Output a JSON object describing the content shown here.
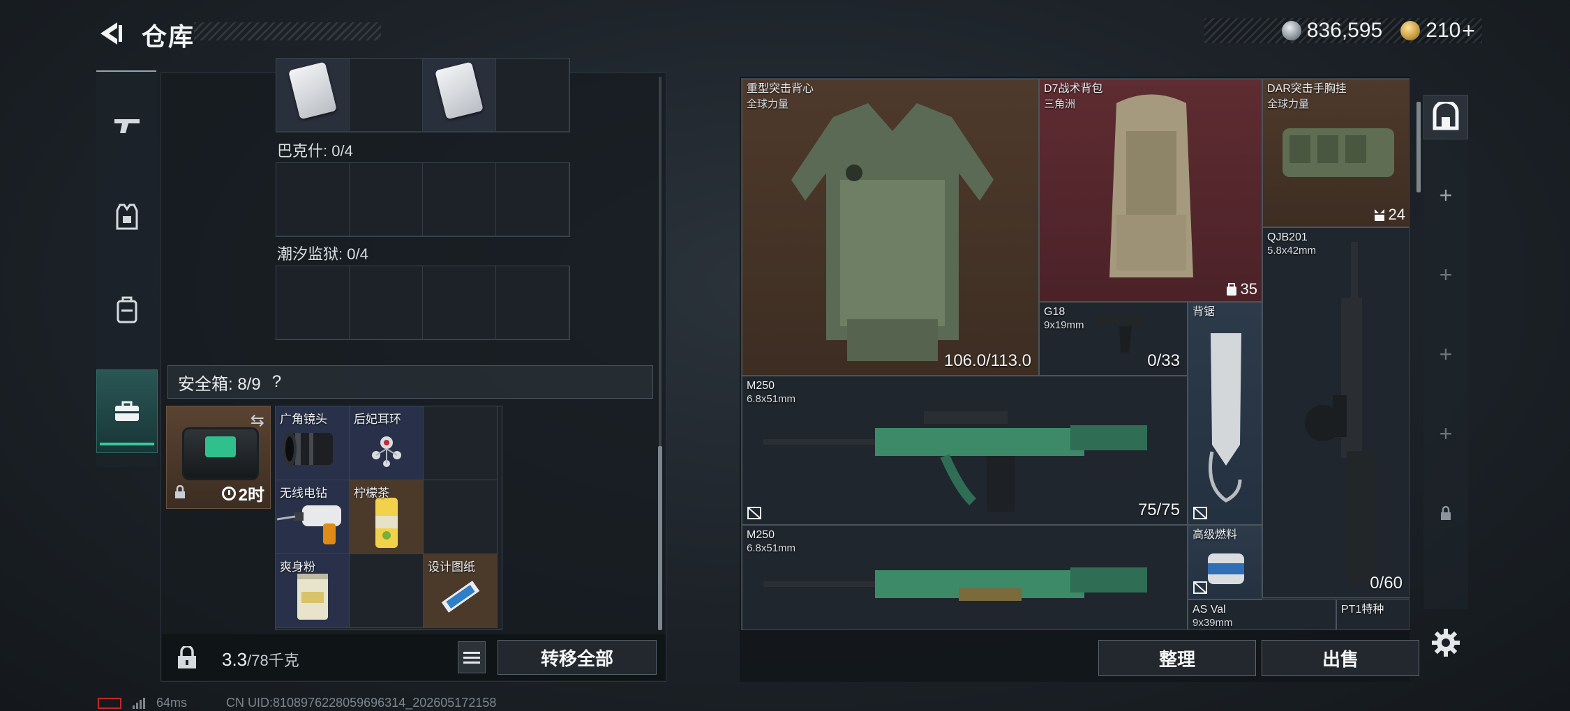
{
  "header": {
    "title": "仓库",
    "currency": [
      {
        "icon": "silver-coin-icon",
        "value": "836,595"
      },
      {
        "icon": "gold-coin-icon",
        "value": "210",
        "suffix": "+"
      }
    ]
  },
  "left_nav": [
    {
      "icon": "gun-icon",
      "active": false
    },
    {
      "icon": "armor-vest-icon",
      "active": false
    },
    {
      "icon": "backpack-icon",
      "active": false
    },
    {
      "icon": "briefcase-icon",
      "active": true
    }
  ],
  "storage": {
    "sections": [
      {
        "label": "巴克什: 0/4"
      },
      {
        "label": "潮汐监狱: 0/4"
      }
    ],
    "safe_box": {
      "label": "安全箱: 8/9",
      "help": "?",
      "timer": "2时",
      "items": [
        {
          "name": "广角镜头",
          "bg": "blue",
          "icon": "camera-lens-icon"
        },
        {
          "name": "后妃耳环",
          "bg": "blue",
          "icon": "earring-icon"
        },
        {
          "name": "无线电钻",
          "bg": "blue",
          "icon": "drill-icon"
        },
        {
          "name": "柠檬茶",
          "bg": "brown",
          "icon": "drink-can-icon"
        },
        {
          "name": "爽身粉",
          "bg": "blue",
          "icon": "powder-tin-icon"
        },
        {
          "name": "",
          "bg": "blank",
          "icon": ""
        },
        {
          "name": "设计图纸",
          "bg": "brown",
          "icon": "blueprint-icon"
        }
      ]
    },
    "weight": {
      "current": "3.3",
      "max_unit": "/78千克"
    },
    "transfer_all": "转移全部"
  },
  "backpack": {
    "items": [
      {
        "id": "vest",
        "name": "重型突击背心",
        "sub": "全球力量",
        "value": "106.0/113.0",
        "bg": "brown"
      },
      {
        "id": "bag",
        "name": "D7战术背包",
        "sub": "三角洲",
        "count": "35",
        "bg": "red"
      },
      {
        "id": "rig",
        "name": "DAR突击手胸挂",
        "sub": "全球力量",
        "count": "24",
        "bg": "brown"
      },
      {
        "id": "qjb",
        "name": "QJB201",
        "sub": "5.8x42mm",
        "value": "0/60",
        "bg": "dark"
      },
      {
        "id": "g18",
        "name": "G18",
        "sub": "9x19mm",
        "value": "0/33",
        "bg": "dark"
      },
      {
        "id": "knife",
        "name": "背锯",
        "sub": "",
        "bg": "blue"
      },
      {
        "id": "m250a",
        "name": "M250",
        "sub": "6.8x51mm",
        "value": "75/75",
        "bg": "dark"
      },
      {
        "id": "m250b",
        "name": "M250",
        "sub": "6.8x51mm",
        "bg": "dark"
      },
      {
        "id": "fuel",
        "name": "高级燃料",
        "sub": "",
        "bg": "blue"
      },
      {
        "id": "asval",
        "name": "AS Val",
        "sub": "9x39mm",
        "bg": "dark"
      },
      {
        "id": "pt1",
        "name": "PT1特种",
        "sub": "",
        "bg": "dark"
      }
    ],
    "buttons": {
      "sort": "整理",
      "sell": "出售"
    }
  },
  "status_bar": {
    "ping": "64ms",
    "uid": "CN UID:8108976228059696314_202605172158"
  },
  "colors": {
    "accent": "#38c9a1",
    "brown_slot": "#4e3a2c",
    "red_slot": "#5e2c31",
    "blue_slot": "#2c3a4a"
  }
}
